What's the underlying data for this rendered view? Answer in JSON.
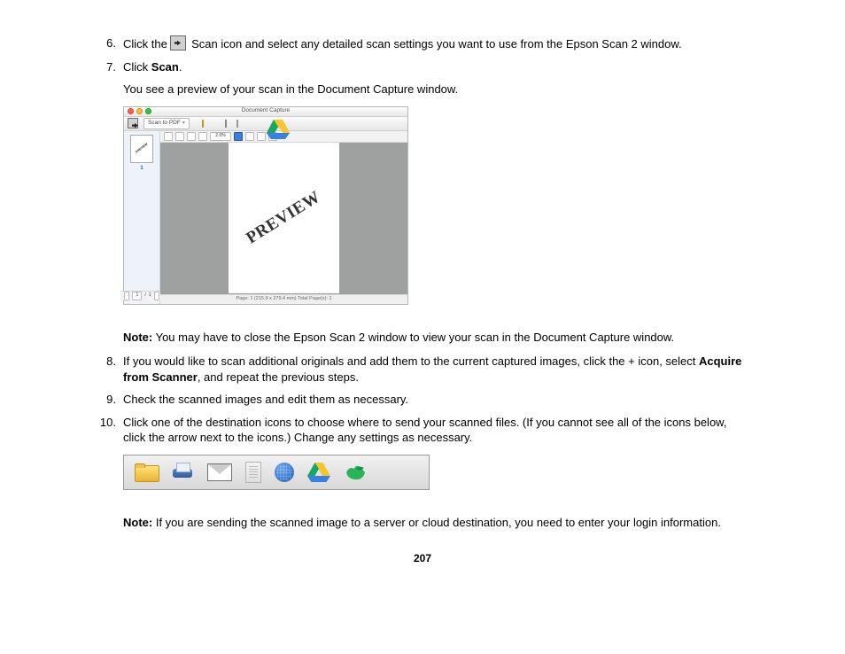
{
  "steps": {
    "s6": {
      "num": "6.",
      "pre": "Click the ",
      "post": " Scan icon and select any detailed scan settings you want to use from the Epson Scan 2 window."
    },
    "s7": {
      "num": "7.",
      "text_a": "Click ",
      "bold_a": "Scan",
      "text_b": ".",
      "sub": "You see a preview of your scan in the Document Capture window."
    },
    "s8": {
      "num": "8.",
      "text_a": "If you would like to scan additional originals and add them to the current captured images, click the + icon, select ",
      "bold": "Acquire from Scanner",
      "text_b": ", and repeat the previous steps."
    },
    "s9": {
      "num": "9.",
      "text": "Check the scanned images and edit them as necessary."
    },
    "s10": {
      "num": "10.",
      "text": "Click one of the destination icons to choose where to send your scanned files. (If you cannot see all of the icons below, click the arrow next to the icons.) Change any settings as necessary."
    }
  },
  "notes": {
    "n1_label": "Note:",
    "n1_text": " You may have to close the Epson Scan 2 window to view your scan in the Document Capture window.",
    "n2_label": "Note:",
    "n2_text": " If you are sending the scanned image to a server or cloud destination, you need to enter your login information."
  },
  "doc_capture": {
    "title": "Document Capture",
    "scan_to": "Scan to PDF",
    "zoom": "2.0%",
    "preview": "PREVIEW",
    "thumb_page": "1",
    "nav_page": "1",
    "nav_of": "1",
    "status": "Page: 1 (215.9 x 279.4 mm)  Total Page(s): 1"
  },
  "page_number": "207"
}
